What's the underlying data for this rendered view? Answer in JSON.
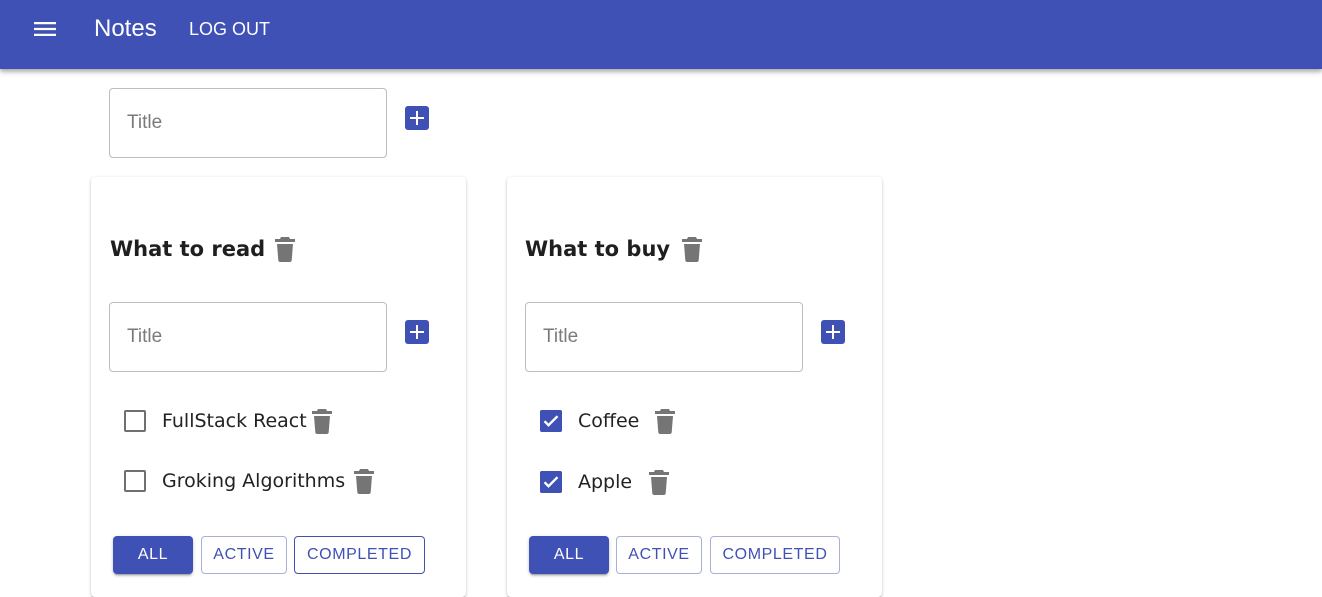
{
  "app": {
    "title": "Notes",
    "logout_label": "LOG OUT",
    "accent_color": "#3f51b5",
    "menu_icon": "menu-icon"
  },
  "new_list": {
    "placeholder": "Title",
    "add_icon": "add-box-icon"
  },
  "lists": [
    {
      "title": "What to read",
      "input_placeholder": "Title",
      "tasks": [
        {
          "label": "FullStack React",
          "done": false
        },
        {
          "label": "Groking Algorithms",
          "done": false
        }
      ],
      "filters": {
        "all": "ALL",
        "active": "ACTIVE",
        "completed": "COMPLETED",
        "selected": "all"
      }
    },
    {
      "title": "What to buy",
      "input_placeholder": "Title",
      "tasks": [
        {
          "label": "Coffee",
          "done": true
        },
        {
          "label": "Apple",
          "done": true
        }
      ],
      "filters": {
        "all": "ALL",
        "active": "ACTIVE",
        "completed": "COMPLETED",
        "selected": "all"
      }
    }
  ]
}
